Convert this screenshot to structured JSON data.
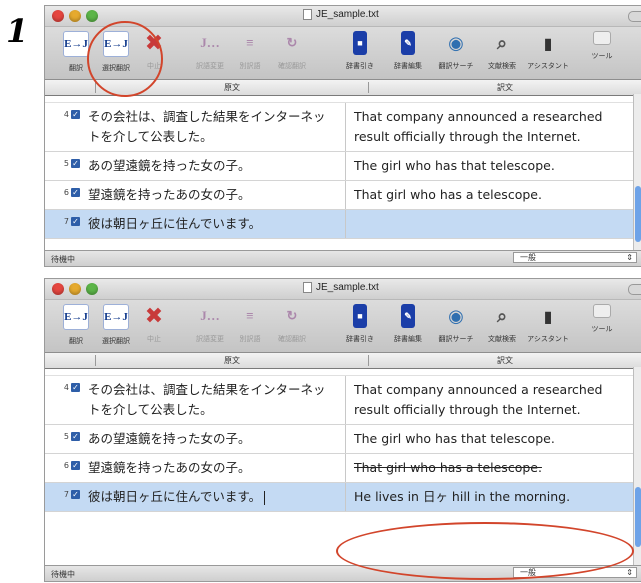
{
  "step_label": "1",
  "window_title": "JE_sample.txt",
  "toolbar": [
    {
      "icon": "ej-translate-icon",
      "glyph": "E→J",
      "label": "翻訳",
      "kind": "ej",
      "disabled": false
    },
    {
      "icon": "selection-translate-icon",
      "glyph": "E→J",
      "label": "選択翻訳",
      "kind": "ej",
      "disabled": false
    },
    {
      "icon": "stop-icon",
      "glyph": "✖",
      "label": "中止",
      "kind": "xmark",
      "disabled": true
    },
    {
      "icon": "alternate-translation-icon",
      "glyph": "J…",
      "label": "訳語変更",
      "kind": "dim",
      "disabled": true
    },
    {
      "icon": "alternate-translation-2-icon",
      "glyph": "≡",
      "label": "別訳語",
      "kind": "dim",
      "disabled": true
    },
    {
      "icon": "confirm-translation-icon",
      "glyph": "↻",
      "label": "確認翻訳",
      "kind": "dim",
      "disabled": true
    },
    {
      "icon": "dictionary-lookup-icon",
      "glyph": "■",
      "label": "辞書引き",
      "kind": "book",
      "disabled": false
    },
    {
      "icon": "dictionary-edit-icon",
      "glyph": "✎",
      "label": "辞書編集",
      "kind": "book",
      "disabled": false
    },
    {
      "icon": "translation-search-icon",
      "glyph": "◉",
      "label": "翻訳サーチ",
      "kind": "search",
      "disabled": false
    },
    {
      "icon": "text-search-icon",
      "glyph": "⌕",
      "label": "文献検索",
      "kind": "mag",
      "disabled": false
    },
    {
      "icon": "assistant-icon",
      "glyph": "▮",
      "label": "アシスタント",
      "kind": "asst",
      "disabled": false
    },
    {
      "icon": "tools-icon",
      "glyph": "",
      "label": "ツール",
      "kind": "tool-gray",
      "disabled": false
    }
  ],
  "columns": {
    "source": "原文",
    "target": "訳文"
  },
  "statusbar": {
    "status": "待機中",
    "mode": "一般"
  },
  "panel1": {
    "rows": [
      {
        "num": "4",
        "src": "その会社は、調査した結果をインターネットを介して公表した。",
        "tgt": "That company announced a researched result officially through the Internet."
      },
      {
        "num": "5",
        "src": "あの望遠鏡を持った女の子。",
        "tgt": "The girl who has that telescope."
      },
      {
        "num": "6",
        "src": "望遠鏡を持ったあの女の子。",
        "tgt": "That girl who has a telescope."
      },
      {
        "num": "7",
        "src": "彼は朝日ヶ丘に住んでいます。",
        "tgt": ""
      }
    ]
  },
  "panel2": {
    "rows": [
      {
        "num": "4",
        "src": "その会社は、調査した結果をインターネットを介して公表した。",
        "tgt": "That company announced a researched result officially through the Internet."
      },
      {
        "num": "5",
        "src": "あの望遠鏡を持った女の子。",
        "tgt": "The girl who has that telescope."
      },
      {
        "num": "6",
        "src": "望遠鏡を持ったあの女の子。",
        "tgt": "That girl who has a telescope."
      },
      {
        "num": "7",
        "src": "彼は朝日ヶ丘に住んでいます。",
        "tgt": "He lives in 日ヶ hill in the morning."
      }
    ]
  },
  "colors": {
    "selection": "#c4daf3",
    "annotation": "#d2452b",
    "checkbox": "#2e5ea8"
  }
}
